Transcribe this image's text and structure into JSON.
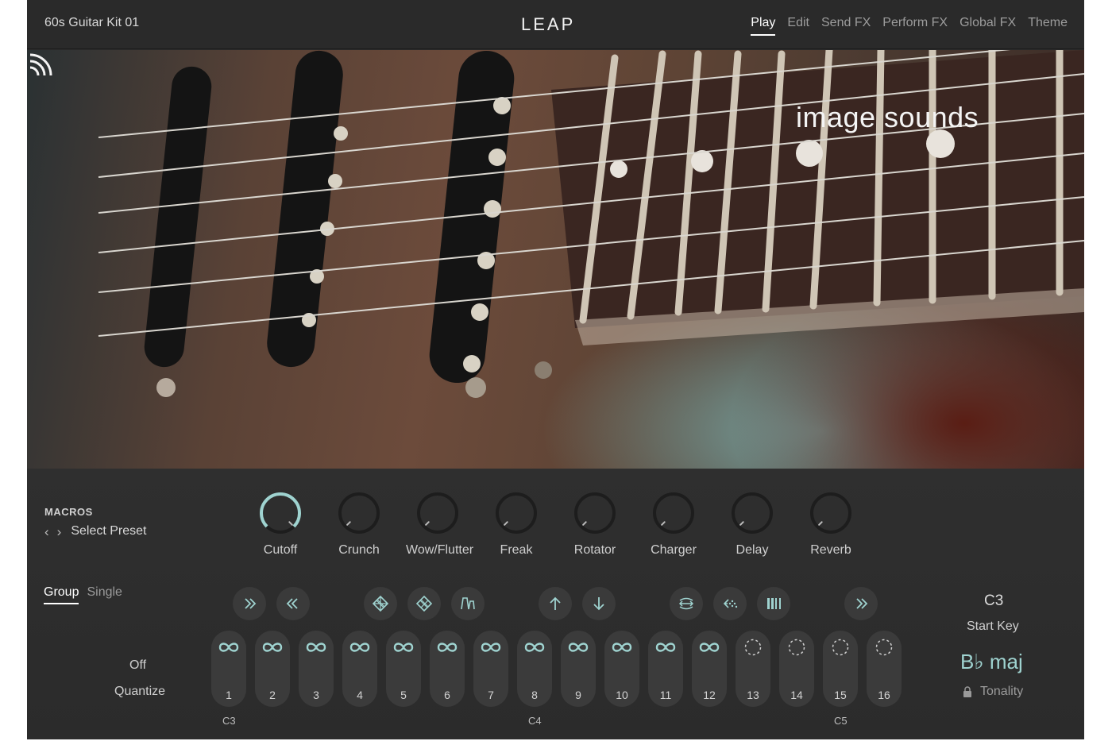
{
  "header": {
    "kit_name": "60s Guitar Kit 01",
    "logo": "LEAP",
    "tabs": [
      {
        "label": "Play",
        "active": true
      },
      {
        "label": "Edit",
        "active": false
      },
      {
        "label": "Send FX",
        "active": false
      },
      {
        "label": "Perform FX",
        "active": false
      },
      {
        "label": "Global FX",
        "active": false
      },
      {
        "label": "Theme",
        "active": false
      }
    ]
  },
  "artwork": {
    "brand": "image sounds",
    "brand_icon": "sound-waves-icon"
  },
  "macros": {
    "title": "MACROS",
    "prev_icon": "chevron-left-icon",
    "next_icon": "chevron-right-icon",
    "preset": "Select Preset",
    "knobs": [
      {
        "label": "Cutoff",
        "value": 1.0
      },
      {
        "label": "Crunch",
        "value": 0.0
      },
      {
        "label": "Wow/Flutter",
        "value": 0.0
      },
      {
        "label": "Freak",
        "value": 0.0
      },
      {
        "label": "Rotator",
        "value": 0.0
      },
      {
        "label": "Charger",
        "value": 0.0
      },
      {
        "label": "Delay",
        "value": 0.0
      },
      {
        "label": "Reverb",
        "value": 0.0
      }
    ]
  },
  "mode_tabs": [
    {
      "label": "Group",
      "active": true
    },
    {
      "label": "Single",
      "active": false
    }
  ],
  "quantize": {
    "value": "Off",
    "label": "Quantize"
  },
  "controls": [
    {
      "icon": "fast-forward-icon"
    },
    {
      "icon": "rewind-icon"
    },
    {
      "icon": "shuffle-pattern-icon"
    },
    {
      "icon": "randomize-pattern-icon"
    },
    {
      "icon": "envelope-icon"
    },
    {
      "icon": "arrow-up-icon"
    },
    {
      "icon": "arrow-down-icon"
    },
    {
      "icon": "reverse-icon"
    },
    {
      "icon": "stutter-icon"
    },
    {
      "icon": "slice-icon"
    },
    {
      "icon": "skip-forward-icon"
    }
  ],
  "pads": [
    {
      "number": "1",
      "state": "loop"
    },
    {
      "number": "2",
      "state": "loop"
    },
    {
      "number": "3",
      "state": "loop"
    },
    {
      "number": "4",
      "state": "loop"
    },
    {
      "number": "5",
      "state": "loop"
    },
    {
      "number": "6",
      "state": "loop"
    },
    {
      "number": "7",
      "state": "loop"
    },
    {
      "number": "8",
      "state": "loop"
    },
    {
      "number": "9",
      "state": "loop"
    },
    {
      "number": "10",
      "state": "loop"
    },
    {
      "number": "11",
      "state": "loop"
    },
    {
      "number": "12",
      "state": "loop"
    },
    {
      "number": "13",
      "state": "oneshot"
    },
    {
      "number": "14",
      "state": "oneshot"
    },
    {
      "number": "15",
      "state": "oneshot"
    },
    {
      "number": "16",
      "state": "oneshot"
    }
  ],
  "key_labels": [
    {
      "label": "C3",
      "pad": 1
    },
    {
      "label": "C4",
      "pad": 8
    },
    {
      "label": "C5",
      "pad": 15
    }
  ],
  "start_key": {
    "value": "C3",
    "label": "Start Key"
  },
  "tonality": {
    "value": "B♭ maj",
    "label": "Tonality",
    "icon": "lock-icon"
  },
  "colors": {
    "accent": "#9fd3d0",
    "panel": "#2b2b2b",
    "pad": "#3b3b3b"
  }
}
